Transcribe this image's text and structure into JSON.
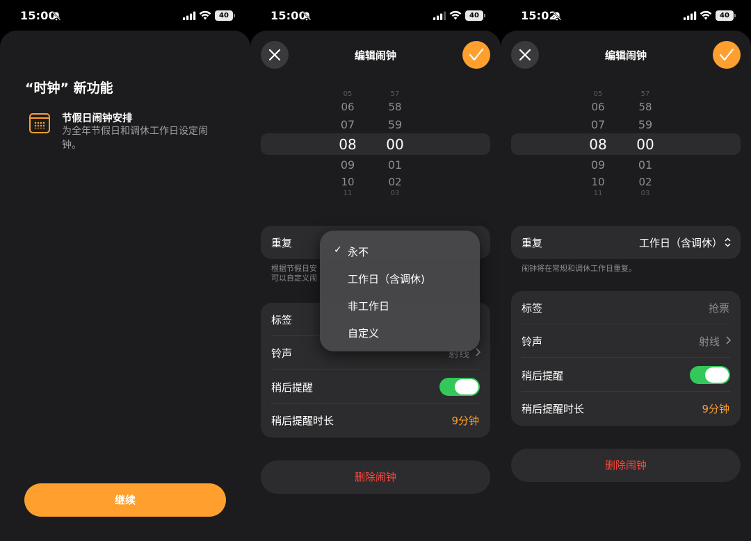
{
  "screen1": {
    "status": {
      "time": "15:00",
      "battery": "40"
    },
    "title": "“时钟” 新功能",
    "feature": {
      "icon": "calendar-icon",
      "title": "节假日闹钟安排",
      "desc": "为全年节假日和调休工作日设定闹钟。"
    },
    "continue_label": "继续"
  },
  "screen2": {
    "status": {
      "time": "15:00",
      "battery": "40"
    },
    "header": {
      "title": "编辑闹钟",
      "close_icon": "close-icon",
      "confirm_icon": "check-icon"
    },
    "picker": {
      "hours": [
        "05",
        "06",
        "07",
        "08",
        "09",
        "10",
        "11"
      ],
      "minutes": [
        "57",
        "58",
        "59",
        "00",
        "01",
        "02",
        "03"
      ]
    },
    "repeat": {
      "label": "重复"
    },
    "hint": "根据节假日安\n可以自定义闹",
    "rows": {
      "label_label": "标签",
      "sound_label": "铃声",
      "sound_value": "射线",
      "snooze_label": "稍后提醒",
      "snooze_on": true,
      "snooze_len_label": "稍后提醒时长",
      "snooze_len_value": "9分钟"
    },
    "menu": {
      "items": [
        "永不",
        "工作日（含调休)",
        "非工作日",
        "自定义"
      ],
      "selected": "永不"
    },
    "delete_label": "删除闹钟"
  },
  "screen3": {
    "status": {
      "time": "15:02",
      "battery": "40"
    },
    "header": {
      "title": "编辑闹钟"
    },
    "picker": {
      "hours": [
        "05",
        "06",
        "07",
        "08",
        "09",
        "10",
        "11"
      ],
      "minutes": [
        "57",
        "58",
        "59",
        "00",
        "01",
        "02",
        "03"
      ]
    },
    "repeat": {
      "label": "重复",
      "value": "工作日（含调休）"
    },
    "hint": "闹钟将在常规和调休工作日重复。",
    "rows": {
      "label_label": "标签",
      "label_value": "抢票",
      "sound_label": "铃声",
      "sound_value": "射线",
      "snooze_label": "稍后提醒",
      "snooze_on": true,
      "snooze_len_label": "稍后提醒时长",
      "snooze_len_value": "9分钟"
    },
    "delete_label": "删除闹钟"
  },
  "colors": {
    "accent": "#ff9f2e",
    "destructive": "#ff453a",
    "toggle_on": "#34c759",
    "card": "#2c2c2e",
    "sheet": "#1c1c1e"
  }
}
